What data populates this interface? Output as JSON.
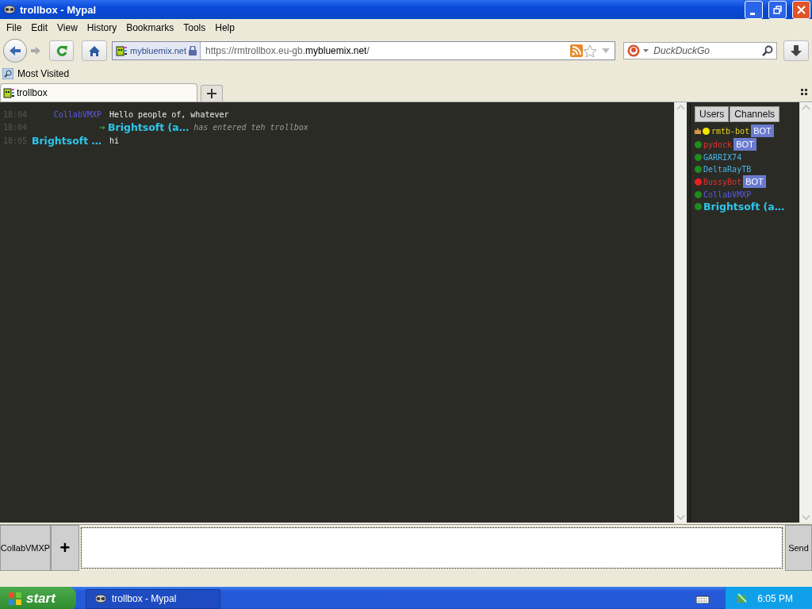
{
  "window": {
    "title": "trollbox - Mypal"
  },
  "menu": [
    {
      "label": "File"
    },
    {
      "label": "Edit"
    },
    {
      "label": "View"
    },
    {
      "label": "History"
    },
    {
      "label": "Bookmarks"
    },
    {
      "label": "Tools"
    },
    {
      "label": "Help"
    }
  ],
  "navbar": {
    "identity": "mybluemix.net",
    "url_prefix": "https://rmtrollbox.eu-gb.",
    "url_domain": "mybluemix.net",
    "url_suffix": "/",
    "search_placeholder": "DuckDuckGo"
  },
  "bookmarks": [
    {
      "label": "Most Visited"
    }
  ],
  "tabs": [
    {
      "label": "trollbox",
      "selected": true
    }
  ],
  "chat": {
    "messages": [
      {
        "kind": "message",
        "time": "18:04",
        "nick": "CollabVMXP",
        "color": "#5a5aec",
        "text": "Hello people of, whatever"
      },
      {
        "kind": "join",
        "time": "18:04",
        "nick": "Brightsoft (a…",
        "color": "#2cc6ea",
        "text": "has entered teh trollbox"
      },
      {
        "kind": "message",
        "time": "18:05",
        "nick": "Brightsoft …",
        "color": "#2cc6ea",
        "text": "hi"
      }
    ]
  },
  "sidebar": {
    "tabs": [
      {
        "label": "Users"
      },
      {
        "label": "Channels"
      }
    ],
    "users": [
      {
        "name": "rmtb-bot",
        "away": true,
        "busy": false,
        "color": "#e6d21e",
        "admin": true,
        "bot": "BOT",
        "kind": "regular"
      },
      {
        "name": "pydock",
        "away": false,
        "busy": false,
        "color": "#e03030",
        "admin": false,
        "bot": "BOT",
        "kind": "regular"
      },
      {
        "name": "GARRIX74",
        "away": false,
        "busy": false,
        "color": "#48b4e6",
        "admin": false,
        "kind": "regular"
      },
      {
        "name": "DeltaRayTB",
        "away": false,
        "busy": false,
        "color": "#48b4e6",
        "admin": false,
        "kind": "regular"
      },
      {
        "name": "BussyBot",
        "away": false,
        "busy": true,
        "color": "#e03030",
        "admin": false,
        "bot": "BOT",
        "kind": "regular"
      },
      {
        "name": "CollabVMXP",
        "away": false,
        "busy": false,
        "color": "#5a5aec",
        "admin": false,
        "kind": "regular"
      },
      {
        "name": "Brightsoft (a…",
        "away": false,
        "busy": false,
        "color": "#2cc6ea",
        "admin": false,
        "kind": "bold"
      }
    ]
  },
  "input": {
    "channel": "CollabVMXP",
    "add": "+",
    "send": "Send"
  },
  "taskbar": {
    "start": "start",
    "task": "trollbox - Mypal",
    "clock": "6:05 PM"
  }
}
